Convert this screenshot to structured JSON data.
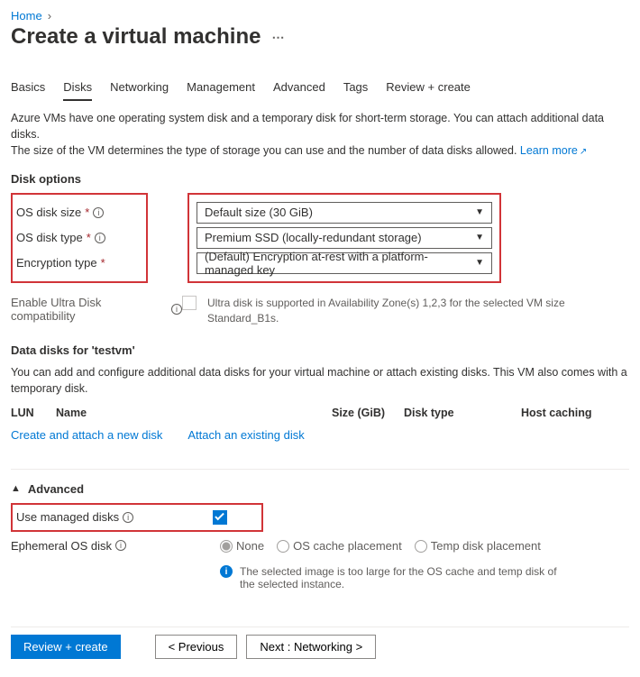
{
  "breadcrumb": {
    "home": "Home"
  },
  "title": "Create a virtual machine",
  "tabs": [
    "Basics",
    "Disks",
    "Networking",
    "Management",
    "Advanced",
    "Tags",
    "Review + create"
  ],
  "active_tab": "Disks",
  "description": {
    "line1": "Azure VMs have one operating system disk and a temporary disk for short-term storage. You can attach additional data disks.",
    "line2_pre": "The size of the VM determines the type of storage you can use and the number of data disks allowed. ",
    "learn_more": "Learn more"
  },
  "disk_options": {
    "heading": "Disk options",
    "os_disk_size": {
      "label": "OS disk size",
      "value": "Default size (30 GiB)"
    },
    "os_disk_type": {
      "label": "OS disk type",
      "value": "Premium SSD (locally-redundant storage)"
    },
    "encryption_type": {
      "label": "Encryption type",
      "value": "(Default) Encryption at-rest with a platform-managed key"
    }
  },
  "ultra": {
    "label": "Enable Ultra Disk compatibility",
    "note": "Ultra disk is supported in Availability Zone(s) 1,2,3 for the selected VM size Standard_B1s."
  },
  "data_disks": {
    "heading": "Data disks for 'testvm'",
    "desc": "You can add and configure additional data disks for your virtual machine or attach existing disks. This VM also comes with a temporary disk.",
    "cols": {
      "lun": "LUN",
      "name": "Name",
      "size": "Size (GiB)",
      "type": "Disk type",
      "cache": "Host caching"
    },
    "create_link": "Create and attach a new disk",
    "attach_link": "Attach an existing disk"
  },
  "advanced": {
    "heading": "Advanced",
    "use_managed": "Use managed disks",
    "ephemeral": {
      "label": "Ephemeral OS disk",
      "none": "None",
      "os_cache": "OS cache placement",
      "temp": "Temp disk placement",
      "note": "The selected image is too large for the OS cache and temp disk of the selected instance."
    }
  },
  "footer": {
    "review": "Review + create",
    "prev": "< Previous",
    "next": "Next : Networking >"
  }
}
